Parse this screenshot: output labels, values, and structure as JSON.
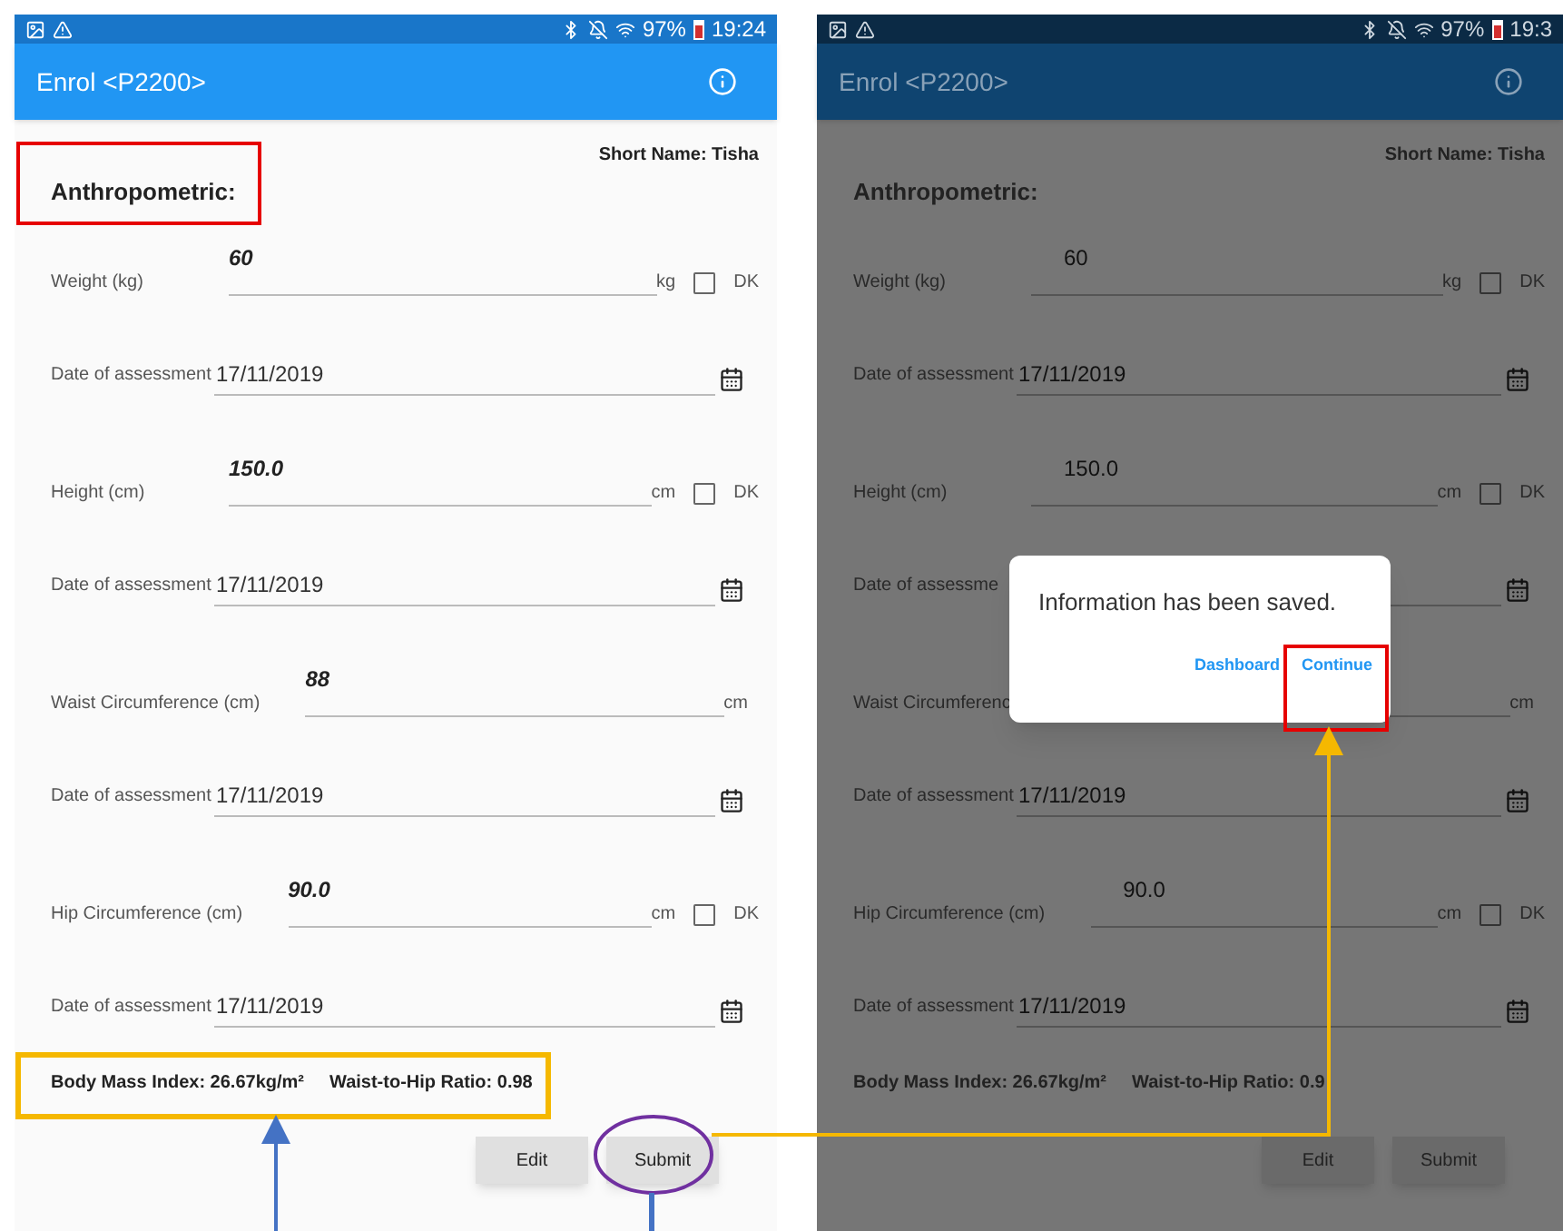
{
  "screens": [
    {
      "dimmed": false,
      "status_bar": {
        "battery": "97%",
        "time": "19:24"
      },
      "app_bar": {
        "title": "Enrol <P2200>"
      },
      "short_name": "Short Name: Tisha",
      "section_title": "Anthropometric:",
      "rows": [
        {
          "kind": "measure",
          "label": "Weight (kg)",
          "value": "60",
          "unit": "kg",
          "dk": {
            "label": "DK",
            "checked": false
          }
        },
        {
          "kind": "date",
          "label": "Date of assessment",
          "value": "17/11/2019"
        },
        {
          "kind": "measure",
          "label": "Height (cm)",
          "value": "150.0",
          "unit": "cm",
          "dk": {
            "label": "DK",
            "checked": false
          }
        },
        {
          "kind": "date",
          "label": "Date of assessment",
          "value": "17/11/2019"
        },
        {
          "kind": "measure",
          "label": "Waist Circumference (cm)",
          "value": "88",
          "unit": "cm"
        },
        {
          "kind": "date",
          "label": "Date of assessment",
          "value": "17/11/2019"
        },
        {
          "kind": "measure",
          "label": "Hip Circumference (cm)",
          "value": "90.0",
          "unit": "cm",
          "dk": {
            "label": "DK",
            "checked": false
          }
        },
        {
          "kind": "date",
          "label": "Date of assessment",
          "value": "17/11/2019"
        }
      ],
      "summary": {
        "bmi": "Body Mass Index: 26.67kg/m²",
        "whr": "Waist-to-Hip Ratio: 0.98"
      },
      "buttons": [
        "Edit",
        "Submit"
      ]
    },
    {
      "dimmed": true,
      "status_bar": {
        "battery": "97%",
        "time": "19:3"
      },
      "app_bar": {
        "title": "Enrol <P2200>"
      },
      "short_name": "Short Name: Tisha",
      "section_title": "Anthropometric:",
      "rows": [
        {
          "kind": "measure",
          "label": "Weight (kg)",
          "value": "60",
          "unit": "kg",
          "dk": {
            "label": "DK",
            "checked": false
          }
        },
        {
          "kind": "date",
          "label": "Date of assessment",
          "value": "17/11/2019"
        },
        {
          "kind": "measure",
          "label": "Height (cm)",
          "value": "150.0",
          "unit": "cm",
          "dk": {
            "label": "DK",
            "checked": false
          }
        },
        {
          "kind": "date",
          "label": "Date of assessme"
        },
        {
          "kind": "measure",
          "label": "Waist Circumferenc",
          "unit": "cm"
        },
        {
          "kind": "date",
          "label": "Date of assessment",
          "value": "17/11/2019"
        },
        {
          "kind": "measure",
          "label": "Hip Circumference (cm)",
          "value": "90.0",
          "unit": "cm",
          "dk": {
            "label": "DK",
            "checked": false
          }
        },
        {
          "kind": "date",
          "label": "Date of assessment",
          "value": "17/11/2019"
        }
      ],
      "summary": {
        "bmi": "Body Mass Index: 26.67kg/m²",
        "whr": "Waist-to-Hip Ratio: 0.9"
      },
      "buttons": [
        "Edit",
        "Submit"
      ],
      "dialog": {
        "message": "Information has been saved.",
        "actions": [
          "Dashboard",
          "Continue"
        ]
      }
    }
  ]
}
